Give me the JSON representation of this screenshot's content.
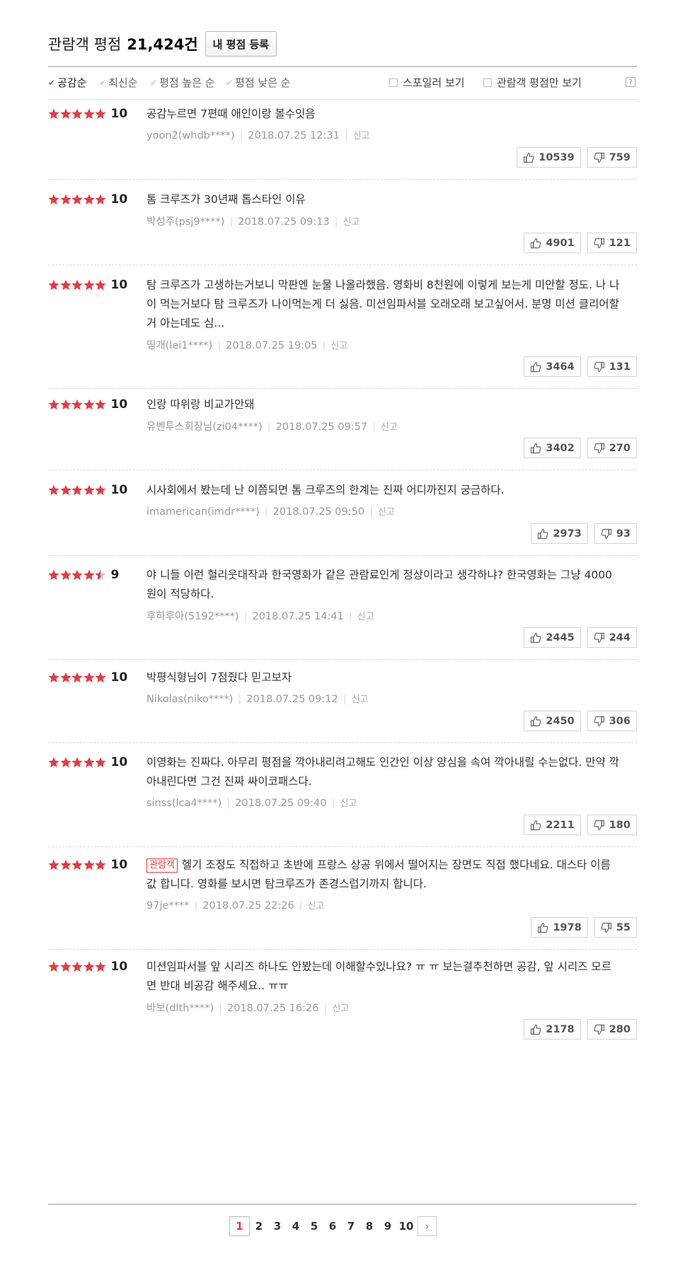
{
  "header": {
    "title": "관람객 평점",
    "count": "21,424건",
    "register_label": "내 평점 등록"
  },
  "sort": {
    "items": [
      {
        "label": "공감순",
        "active": true
      },
      {
        "label": "최신순",
        "active": false
      },
      {
        "label": "평점 높은 순",
        "active": false
      },
      {
        "label": "평점 낮은 순",
        "active": false
      }
    ],
    "spoiler_label": "스포일러 보기",
    "audience_only_label": "관람객 평점만 보기",
    "help_label": "?"
  },
  "reviews": [
    {
      "stars": 5,
      "score": "10",
      "badge": "",
      "text": "공감누르면 7편때 애인이랑 볼수잇음",
      "author": "yoon2(whdb****)",
      "date": "2018.07.25 12:31",
      "report": "신고",
      "likes": "10539",
      "dislikes": "759"
    },
    {
      "stars": 5,
      "score": "10",
      "badge": "",
      "text": "톰 크루즈가 30년째 톱스타인 이유",
      "author": "박성주(psj9****)",
      "date": "2018.07.25 09:13",
      "report": "신고",
      "likes": "4901",
      "dislikes": "121"
    },
    {
      "stars": 5,
      "score": "10",
      "badge": "",
      "text": "탐 크루즈가 고생하는거보니 막판엔 눈물 나올라했음. 영화비 8천원에 이렇게 보는게 미안할 정도. 나 나이 먹는거보다 탐 크루즈가 나이먹는게 더 싫음. 미션임파서블 오래오래 보고싶어서. 분명 미션 클리어할거 아는데도 심...",
      "author": "띵개(lei1****)",
      "date": "2018.07.25 19:05",
      "report": "신고",
      "likes": "3464",
      "dislikes": "131"
    },
    {
      "stars": 5,
      "score": "10",
      "badge": "",
      "text": "인랑 따위랑 비교가안돼",
      "author": "유벤투스회장님(zi04****)",
      "date": "2018.07.25 09:57",
      "report": "신고",
      "likes": "3402",
      "dislikes": "270"
    },
    {
      "stars": 5,
      "score": "10",
      "badge": "",
      "text": "시사회에서 봤는데 난 이쯤되면 톰 크루즈의 한계는 진짜 어디까진지 궁금하다.",
      "author": "imamerican(imdr****)",
      "date": "2018.07.25 09:50",
      "report": "신고",
      "likes": "2973",
      "dislikes": "93"
    },
    {
      "stars": 4.5,
      "score": "9",
      "badge": "",
      "text": "야 니들 이런 헐리웃대작과 한국영화가 같은 관람료인게 정상이라고 생각하냐? 한국영화는 그냥 4000원이 적당하다.",
      "author": "후하후아(5192****)",
      "date": "2018.07.25 14:41",
      "report": "신고",
      "likes": "2445",
      "dislikes": "244"
    },
    {
      "stars": 5,
      "score": "10",
      "badge": "",
      "text": "박평식형님이 7점줬다 믿고보자",
      "author": "Nikolas(niko****)",
      "date": "2018.07.25 09:12",
      "report": "신고",
      "likes": "2450",
      "dislikes": "306"
    },
    {
      "stars": 5,
      "score": "10",
      "badge": "",
      "text": "이영화는 진짜다. 아무리 평점을 깍아내리려고해도 인간인 이상 양심을 속여 깍아내릴 수는없다. 만약 깍아내린다면 그건 진짜 싸이코패스다.",
      "author": "sinss(lca4****)",
      "date": "2018.07.25 09:40",
      "report": "신고",
      "likes": "2211",
      "dislikes": "180"
    },
    {
      "stars": 5,
      "score": "10",
      "badge": "관람객",
      "text": "헬기 조정도 직접하고 초반에 프랑스 상공 위에서 떨어지는 장면도 직접 했다네요. 대스타 이름값 합니다. 영화를 보시면 탐크루즈가 존경스럽기까지 합니다.",
      "author": "97je****",
      "date": "2018.07.25 22:26",
      "report": "신고",
      "likes": "1978",
      "dislikes": "55"
    },
    {
      "stars": 5,
      "score": "10",
      "badge": "",
      "text": "미션임파서블 앞 시리즈 하나도 안봤는데 이해할수있나요? ㅠ ㅠ 보는걸추천하면 공감, 앞 시리즈 모르면 반대 비공감 해주세요.. ㅠㅠ",
      "author": "바보(dlth****)",
      "date": "2018.07.25 16:26",
      "report": "신고",
      "likes": "2178",
      "dislikes": "280"
    }
  ],
  "pagination": {
    "pages": [
      "1",
      "2",
      "3",
      "4",
      "5",
      "6",
      "7",
      "8",
      "9",
      "10"
    ],
    "current": "1",
    "next": "›"
  },
  "colors": {
    "accent": "#e53a40",
    "star": "#e53a40",
    "star_empty": "#cccccc"
  }
}
